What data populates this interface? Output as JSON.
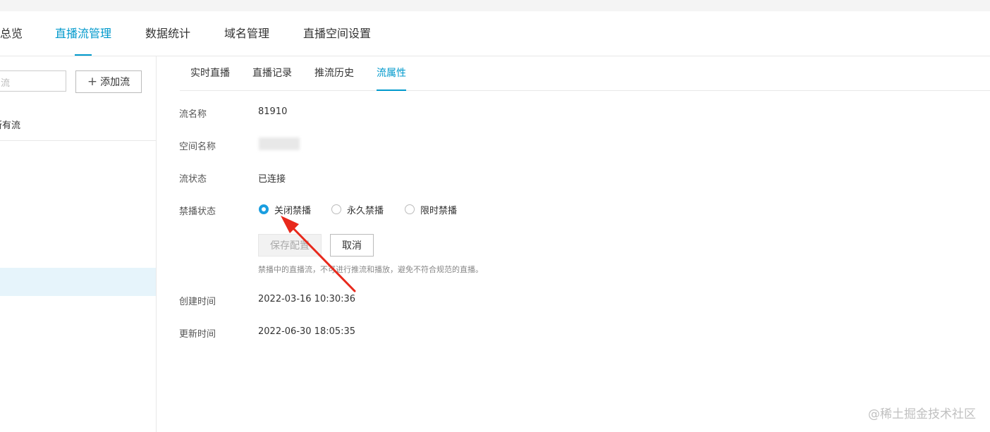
{
  "top_nav": {
    "tabs": [
      {
        "label": "总览"
      },
      {
        "label": "直播流管理"
      },
      {
        "label": "数据统计"
      },
      {
        "label": "域名管理"
      },
      {
        "label": "直播空间设置"
      }
    ],
    "active_index": 1
  },
  "left_panel": {
    "search_placeholder": "流",
    "add_button_label": "添加流",
    "filter_label": "所有流"
  },
  "sub_tabs": {
    "tabs": [
      {
        "label": "实时直播"
      },
      {
        "label": "直播记录"
      },
      {
        "label": "推流历史"
      },
      {
        "label": "流属性"
      }
    ],
    "active_index": 3
  },
  "details": {
    "stream_name_label": "流名称",
    "stream_name_value": "81910",
    "space_name_label": "空间名称",
    "stream_status_label": "流状态",
    "stream_status_value": "已连接",
    "ban_status_label": "禁播状态",
    "ban_options": [
      "关闭禁播",
      "永久禁播",
      "限时禁播"
    ],
    "ban_selected": "关闭禁播",
    "save_button_label": "保存配置",
    "cancel_button_label": "取消",
    "hint_text": "禁播中的直播流，不可进行推流和播放，避免不符合规范的直播。",
    "created_label": "创建时间",
    "created_value": "2022-03-16 10:30:36",
    "updated_label": "更新时间",
    "updated_value": "2022-06-30 18:05:35"
  },
  "watermark": "@稀土掘金技术社区",
  "colors": {
    "accent": "#0099cc",
    "radio_checked": "#1a9ee0",
    "annotation_arrow": "#e8291c"
  }
}
